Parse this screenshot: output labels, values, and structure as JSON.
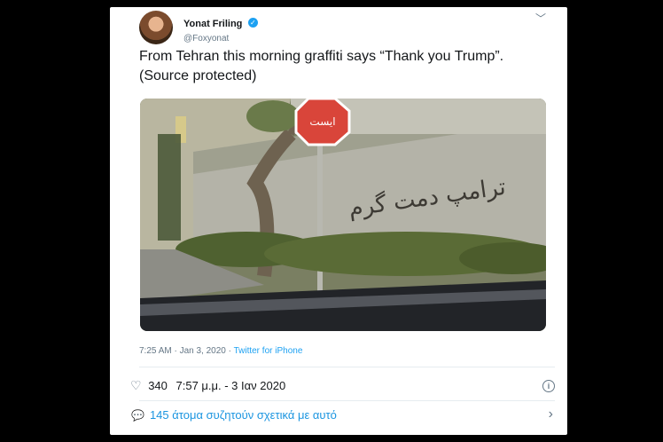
{
  "tweet": {
    "author_name": "Yonat Friling",
    "handle": "@Foxyonat",
    "text": "From Tehran this morning graffiti says “Thank you Trump”. (Source protected)",
    "graffiti_text": "ترامپ دمت گرم",
    "stop_sign_text": "ایست",
    "timestamp": "7:25 AM · Jan 3, 2020 ·",
    "source": "Twitter for iPhone"
  },
  "stats": {
    "likes": "340",
    "time": "7:57 μ.μ. - 3 Ιαν 2020"
  },
  "footer": {
    "label": "145 άτομα συζητούν σχετικά με αυτό"
  },
  "colors": {
    "link": "#1da1f2",
    "text": "#14171a",
    "muted": "#657786"
  },
  "icons": [
    "verified-badge-icon",
    "chevron-down-icon",
    "heart-icon",
    "info-icon",
    "chat-bubble-icon",
    "chevron-right-icon"
  ]
}
